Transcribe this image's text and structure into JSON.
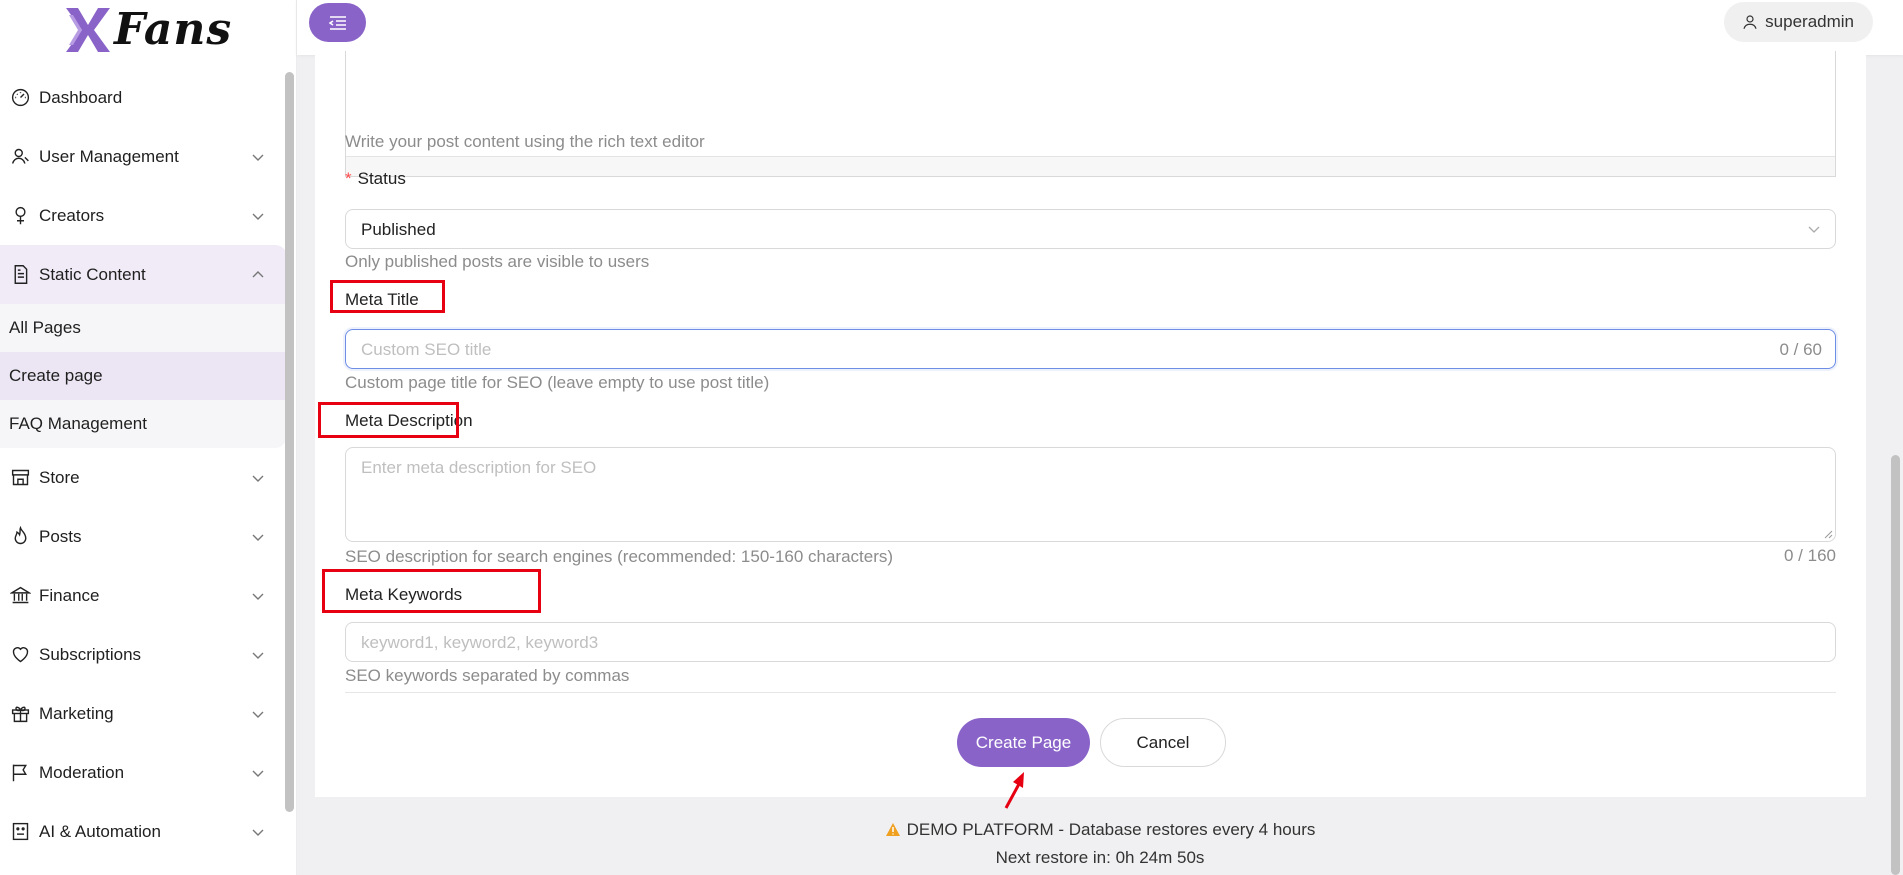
{
  "brand": {
    "name": "Fans"
  },
  "header": {
    "user": "superadmin"
  },
  "sidebar": {
    "items": [
      {
        "label": "Dashboard",
        "icon": "dashboard-icon",
        "has_children": false
      },
      {
        "label": "User Management",
        "icon": "user-icon",
        "has_children": true
      },
      {
        "label": "Creators",
        "icon": "creators-icon",
        "has_children": true
      },
      {
        "label": "Static Content",
        "icon": "document-icon",
        "has_children": true,
        "expanded": true
      },
      {
        "label": "Store",
        "icon": "store-icon",
        "has_children": true
      },
      {
        "label": "Posts",
        "icon": "fire-icon",
        "has_children": true
      },
      {
        "label": "Finance",
        "icon": "bank-icon",
        "has_children": true
      },
      {
        "label": "Subscriptions",
        "icon": "heart-icon",
        "has_children": true
      },
      {
        "label": "Marketing",
        "icon": "gift-icon",
        "has_children": true
      },
      {
        "label": "Moderation",
        "icon": "flag-icon",
        "has_children": true
      },
      {
        "label": "AI & Automation",
        "icon": "robot-icon",
        "has_children": true
      }
    ],
    "static_content_sub": [
      {
        "label": "All Pages"
      },
      {
        "label": "Create page",
        "current": true
      },
      {
        "label": "FAQ Management"
      }
    ]
  },
  "form": {
    "content_help": "Write your post content using the rich text editor",
    "status": {
      "label": "Status",
      "value": "Published",
      "help": "Only published posts are visible to users"
    },
    "meta_title": {
      "label": "Meta Title",
      "placeholder": "Custom SEO title",
      "counter": "0 / 60",
      "help": "Custom page title for SEO (leave empty to use post title)"
    },
    "meta_description": {
      "label": "Meta Description",
      "placeholder": "Enter meta description for SEO",
      "counter": "0 / 160",
      "help": "SEO description for search engines (recommended: 150-160 characters)"
    },
    "meta_keywords": {
      "label": "Meta Keywords",
      "placeholder": "keyword1, keyword2, keyword3",
      "help": "SEO keywords separated by commas"
    },
    "actions": {
      "submit": "Create Page",
      "cancel": "Cancel"
    }
  },
  "footer": {
    "warning_title": "DEMO PLATFORM",
    "warning_text": " - Database restores every 4 hours",
    "restore": "Next restore in: 0h 24m 50s"
  },
  "colors": {
    "accent": "#8a63c9",
    "highlight": "#e60012",
    "focus": "#6e8ee6"
  }
}
